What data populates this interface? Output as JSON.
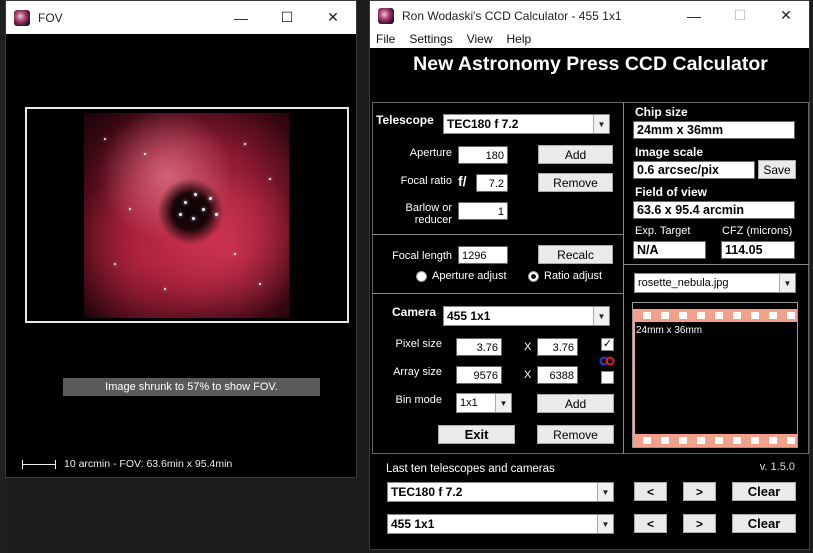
{
  "fov_window": {
    "title": "FOV",
    "note": "Image shrunk to 57% to show FOV.",
    "scale_text": "10 arcmin - FOV: 63.6min x 95.4min"
  },
  "ccd_window": {
    "title": "Ron Wodaski's CCD Calculator - 455 1x1",
    "menu": [
      "File",
      "Settings",
      "View",
      "Help"
    ],
    "app_title": "New Astronomy Press CCD Calculator",
    "telescope": {
      "label": "Telescope",
      "selected": "TEC180 f 7.2",
      "aperture_label": "Aperture",
      "aperture": "180",
      "focal_ratio_label": "Focal ratio",
      "f_prefix": "f/",
      "focal_ratio": "7.2",
      "barlow_label_1": "Barlow or",
      "barlow_label_2": "reducer",
      "barlow": "1",
      "add": "Add",
      "remove": "Remove",
      "focal_length_label": "Focal length",
      "focal_length": "1296",
      "recalc": "Recalc",
      "aperture_adjust": "Aperture adjust",
      "ratio_adjust": "Ratio adjust",
      "ratio_adjust_selected": true
    },
    "camera": {
      "label": "Camera",
      "selected": "455 1x1",
      "pixel_size_label": "Pixel size",
      "pixel_w": "3.76",
      "pixel_h": "3.76",
      "array_size_label": "Array size",
      "array_w": "9576",
      "array_h": "6388",
      "x_symbol": "X",
      "bin_mode_label": "Bin mode",
      "bin_mode": "1x1",
      "add": "Add",
      "remove": "Remove",
      "lock_checked": true,
      "check2_checked": false
    },
    "exit": "Exit",
    "results": {
      "chip_size_label": "Chip size",
      "chip_size": "24mm x 36mm",
      "image_scale_label": "Image scale",
      "image_scale": "0.6 arcsec/pix",
      "save": "Save",
      "fov_label": "Field of view",
      "fov": "63.6 x 95.4 arcmin",
      "exp_target_label": "Exp. Target",
      "exp_target": "N/A",
      "cfz_label": "CFZ (microns)",
      "cfz": "114.05",
      "image_file": "rosette_nebula.jpg",
      "preview_caption": "24mm x 36mm"
    },
    "history": {
      "label": "Last ten telescopes and cameras",
      "version": "v. 1.5.0",
      "telescope": "TEC180 f 7.2",
      "camera": "455 1x1",
      "prev": "<",
      "next": ">",
      "clear": "Clear"
    }
  },
  "colors": {
    "window_bg": "#000000",
    "preview_strip": "#f3a08a"
  }
}
